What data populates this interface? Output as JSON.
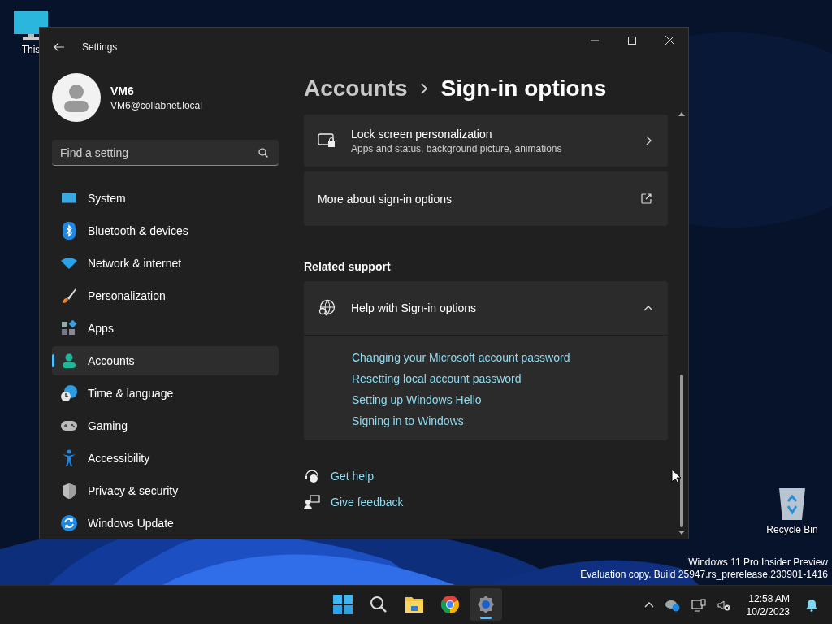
{
  "desktop": {
    "icons": [
      {
        "label": "This"
      },
      {
        "label": "Recycle Bin"
      }
    ],
    "watermark": [
      "Windows 11 Pro Insider Preview",
      "Evaluation copy. Build 25947.rs_prerelease.230901-1416"
    ]
  },
  "window": {
    "title": "Settings"
  },
  "profile": {
    "name": "VM6",
    "email": "VM6@collabnet.local"
  },
  "search": {
    "placeholder": "Find a setting"
  },
  "sidebar": {
    "items": [
      {
        "label": "System",
        "selected": false
      },
      {
        "label": "Bluetooth & devices",
        "selected": false
      },
      {
        "label": "Network & internet",
        "selected": false
      },
      {
        "label": "Personalization",
        "selected": false
      },
      {
        "label": "Apps",
        "selected": false
      },
      {
        "label": "Accounts",
        "selected": true
      },
      {
        "label": "Time & language",
        "selected": false
      },
      {
        "label": "Gaming",
        "selected": false
      },
      {
        "label": "Accessibility",
        "selected": false
      },
      {
        "label": "Privacy & security",
        "selected": false
      },
      {
        "label": "Windows Update",
        "selected": false
      }
    ]
  },
  "breadcrumb": [
    "Accounts",
    "Sign-in options"
  ],
  "cards": [
    {
      "kind": "nav",
      "title": "Lock screen personalization",
      "subtitle": "Apps and status, background picture, animations"
    },
    {
      "kind": "external",
      "title": "More about sign-in options"
    }
  ],
  "related_support": {
    "heading": "Related support",
    "title": "Help with Sign-in options",
    "expanded": true,
    "links": [
      "Changing your Microsoft account password",
      "Resetting local account password",
      "Setting up Windows Hello",
      "Signing in to Windows"
    ]
  },
  "help_links": [
    {
      "kind": "help",
      "label": "Get help"
    },
    {
      "kind": "feedback",
      "label": "Give feedback"
    }
  ],
  "taskbar": {
    "pinned": [
      {
        "selected": false
      },
      {
        "selected": false
      },
      {
        "selected": true
      }
    ],
    "clock": {
      "time": "12:58 AM",
      "date": "10/2/2023"
    }
  }
}
